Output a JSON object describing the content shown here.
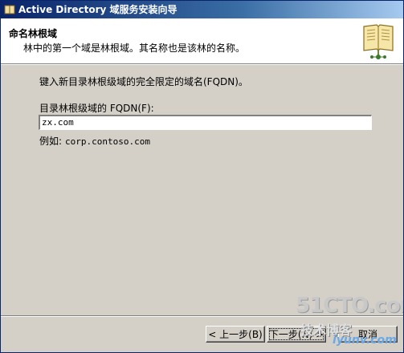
{
  "window": {
    "title": "Active Directory 域服务安装向导"
  },
  "header": {
    "title": "命名林根域",
    "subtitle": "林中的第一个域是林根域。其名称也是该林的名称。",
    "icon": "book-icon"
  },
  "main": {
    "prompt": "键入新目录林根级域的完全限定的域名(FQDN)。",
    "field_label": "目录林根级域的 FQDN(F):",
    "field_value": "zx.com",
    "example_label": "例如:",
    "example_value": "corp.contoso.com"
  },
  "buttons": {
    "back": "< 上一步(B)",
    "next": "下一步(N) >",
    "cancel": "取消"
  },
  "watermark": {
    "line1": "51CTO.com",
    "line2": "技术博客",
    "line3": "iyunv.com"
  }
}
